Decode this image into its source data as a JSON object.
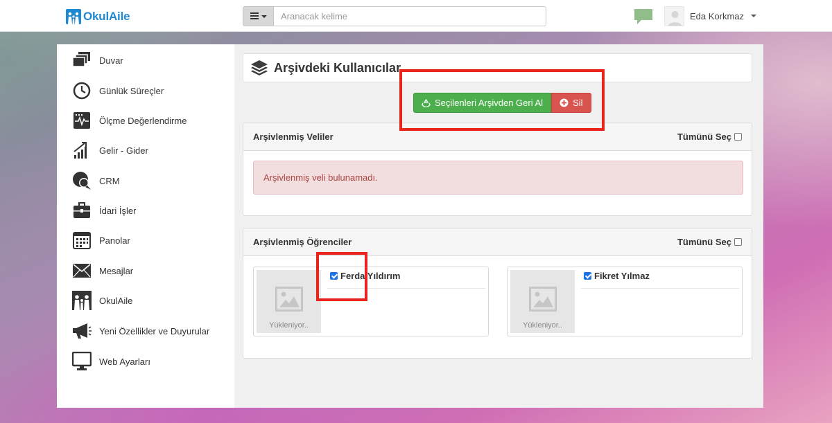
{
  "header": {
    "brand": "OkulAile",
    "search": {
      "placeholder": "Aranacak kelime",
      "value": ""
    },
    "user": {
      "name": "Eda Korkmaz"
    }
  },
  "sidebar": {
    "items": [
      {
        "label": "Duvar",
        "icon": "wall-icon"
      },
      {
        "label": "Günlük Süreçler",
        "icon": "clock-icon"
      },
      {
        "label": "Ölçme Değerlendirme",
        "icon": "monitor-chart-icon"
      },
      {
        "label": "Gelir - Gider",
        "icon": "growth-chart-icon"
      },
      {
        "label": "CRM",
        "icon": "chat-bubbles-icon"
      },
      {
        "label": "İdari İşler",
        "icon": "briefcase-icon"
      },
      {
        "label": "Panolar",
        "icon": "calendar-icon"
      },
      {
        "label": "Mesajlar",
        "icon": "envelope-icon"
      },
      {
        "label": "OkulAile",
        "icon": "family-icon"
      },
      {
        "label": "Yeni Özellikler ve Duyurular",
        "icon": "megaphone-icon"
      },
      {
        "label": "Web Ayarları",
        "icon": "desktop-icon"
      }
    ]
  },
  "main": {
    "title": "Arşivdeki Kullanıcılar",
    "actions": {
      "restore_label": "Seçilenleri Arşivden Geri Al",
      "delete_label": "Sil"
    },
    "parents_panel": {
      "title": "Arşivlenmiş Veliler",
      "select_all_label": "Tümünü Seç",
      "empty_message": "Arşivlenmiş veli bulunamadı."
    },
    "students_panel": {
      "title": "Arşivlenmiş Öğrenciler",
      "select_all_label": "Tümünü Seç",
      "students": [
        {
          "name": "Ferda Yıldırım",
          "checked": true,
          "photo_status": "Yükleniyor.."
        },
        {
          "name": "Fikret Yılmaz",
          "checked": true,
          "photo_status": "Yükleniyor.."
        }
      ]
    }
  },
  "colors": {
    "brand": "#1e88d2",
    "success": "#4cae4c",
    "danger": "#d9534f",
    "alert_bg": "#f2dede",
    "alert_text": "#a94442",
    "highlight": "#e8241d"
  }
}
